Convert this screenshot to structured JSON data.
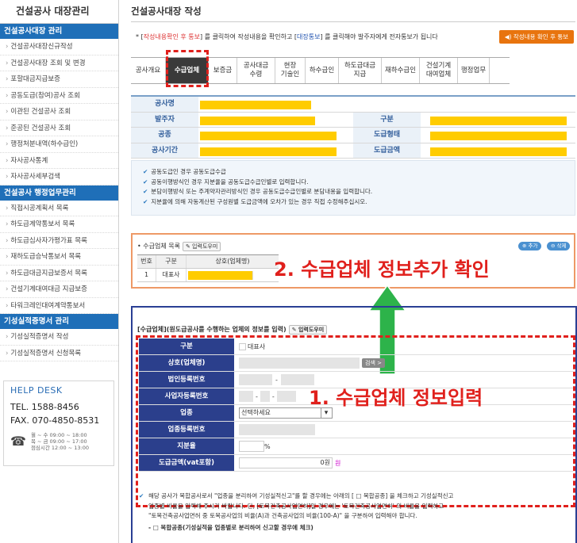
{
  "sidebar": {
    "title": "건설공사 대장관리",
    "sections": [
      {
        "label": "건설공사대장 관리",
        "items": [
          "건설공사대장신규작성",
          "건설공사대장 조회 및 변경",
          "포할대금지급보증",
          "공동도급(참여)공사 조회",
          "이관된 건설공사 조회",
          "준공된 건설공사 조회",
          "행정처분내역(하수급인)",
          "자사공사통계",
          "자사공사세부검색"
        ]
      },
      {
        "label": "건설공사 행정업무관리",
        "items": [
          "직접시공계획서 목록",
          "하도급계약통보서 목록",
          "하도급심사자가평가표 목록",
          "재하도급승낙통보서 목록",
          "하도급대금지급보증서 목록",
          "건설기계대여대금 지급보증",
          "타워크레인대여계약통보서"
        ]
      },
      {
        "label": "기성실적증명서 관리",
        "items": [
          "기성실적증명서 작성",
          "기성실적증명서 신청목록"
        ]
      }
    ],
    "help": {
      "title": "HELP DESK",
      "tel": "TEL. 1588-8456",
      "fax": "FAX. 070-4850-8531",
      "hours": [
        "월 ~ 수  09:00 ~ 18:00",
        "목 ~ 금  09:00 ~ 17:00",
        "점심시간  12:00 ~ 13:00"
      ]
    }
  },
  "main": {
    "page_title": "건설공사대장 작성",
    "instruction": {
      "prefix": "* [",
      "red1": "작성내용확인 후 통보",
      "mid1": "] 를 클릭하여 작성내용을 확인하고 [",
      "blue": "대장통보",
      "mid2": "] 를 클릭해야 발주자에게 전자통보가 됩니다"
    },
    "notify_button": "◀) 작성내용 확인 후 통보",
    "tabs": [
      "공사개요",
      "수급업체",
      "보증금",
      "공사대금\n수령",
      "현장\n기술인",
      "하수급인",
      "하도급대금\n지급",
      "재하수급인",
      "건설기계\n대여업체",
      "행정업무"
    ],
    "active_tab": 1,
    "summary": {
      "project_name": "공사명",
      "client": "발주자",
      "category": "구분",
      "work_type": "공종",
      "subcontract_type": "도급형태",
      "period": "공사기간",
      "contract_amount": "도급금액"
    },
    "notes": [
      "공동도급인 경우 공동도급수급",
      "공동이행방식인 경우 지분율을 공동도급수급인별로 입력합니다.",
      "분담이행방식 또는 주계약자관리방식인 경우 공동도급수급인별로 분담내용을 입력합니다.",
      "지분율에 의해 자동계산된 구성원별 도급금액에 오차가 있는 경우 직접 수정해주십시오."
    ],
    "company_list": {
      "label": "• 수급업체 목록",
      "help_btn": "✎ 입력도우미",
      "add_btn": "⊕ 추가",
      "del_btn": "⊖ 삭제",
      "headers": [
        "번호",
        "구분",
        "상호(업체명)"
      ],
      "rows": [
        {
          "no": "1",
          "type": "대표사"
        }
      ]
    },
    "annotation2": "2. 수급업체 정보추가 확인",
    "form": {
      "label": "[수급업체](원도급공사를 수행하는 업체의 정보를 입력)",
      "help_btn": "✎ 입력도우미",
      "fields": {
        "category": "구분",
        "rep_checkbox": "대표사",
        "company": "상호(업체명)",
        "search_btn": "검색 >",
        "corp_no": "법인등록번호",
        "biz_no": "사업자등록번호",
        "industry": "업종",
        "industry_select": "선택하세요",
        "industry_reg": "업종등록번호",
        "share": "지분율",
        "percent": "%",
        "amount": "도급금액(vat포함)",
        "amount_value": "0원",
        "won": "원"
      },
      "annotation1": "1. 수급업체 정보입력",
      "bottom_note": [
        "해당 공사가 복합공사로서 \"업종을 분리하여 기성실적신고\"를 할 경우에는 아래의 [ □ 복합공종] 을 체크하고 기성실적신고",
        "업종별 비율을 입력해 주시기 바랍니다. 단, [토목건축공사업면허]일 경우에는 '토목건축공사업면허' 의 비율을 입력하고",
        "\"토목건축공사업면허 중 토목공사업의 비율(A)과 건축공사업의 비율(100-A)\" 을 구분하여 입력해야 합니다."
      ],
      "joint_label": "- □ 복합공종(기성실적을 업종별로 분리하여 신고할 경우에 체크)"
    }
  },
  "colors": {
    "accent": "#1f6fb8",
    "highlight": "#ffcc00",
    "annotation": "#e0201c",
    "arrow": "#2db34a",
    "form_header": "#2b3f8c",
    "orange_btn": "#e8740e"
  }
}
